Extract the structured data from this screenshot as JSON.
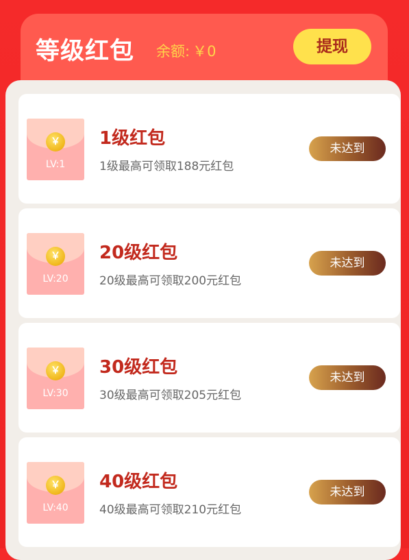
{
  "header": {
    "title": "等级红包",
    "balance_label": "余额:",
    "balance_value": "￥0",
    "withdraw_label": "提现"
  },
  "cards": [
    {
      "lv": "LV:1",
      "title": "1级红包",
      "desc": "1级最高可领取188元红包",
      "status": "未达到",
      "coin": "￥"
    },
    {
      "lv": "LV:20",
      "title": "20级红包",
      "desc": "20级最高可领取200元红包",
      "status": "未达到",
      "coin": "￥"
    },
    {
      "lv": "LV:30",
      "title": "30级红包",
      "desc": "30级最高可领取205元红包",
      "status": "未达到",
      "coin": "￥"
    },
    {
      "lv": "LV:40",
      "title": "40级红包",
      "desc": "40级最高可领取210元红包",
      "status": "未达到",
      "coin": "￥"
    }
  ],
  "colors": {
    "background": "#f52a2a",
    "header": "#ff5a4f",
    "withdraw_button": "#ffe14c",
    "card_title": "#c2291d",
    "balance_text": "#ffd54a"
  }
}
